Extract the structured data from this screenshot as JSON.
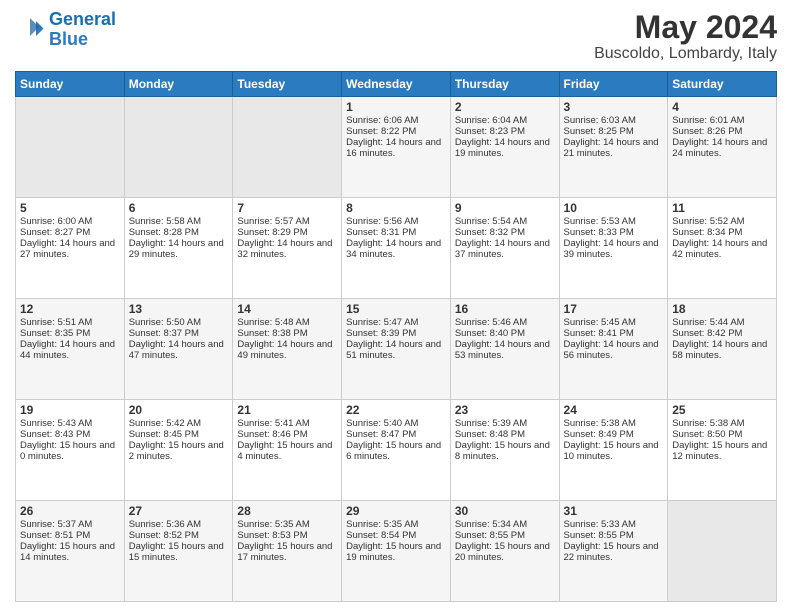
{
  "logo": {
    "line1": "General",
    "line2": "Blue"
  },
  "title": "May 2024",
  "location": "Buscoldo, Lombardy, Italy",
  "days_of_week": [
    "Sunday",
    "Monday",
    "Tuesday",
    "Wednesday",
    "Thursday",
    "Friday",
    "Saturday"
  ],
  "weeks": [
    [
      {
        "day": "",
        "empty": true
      },
      {
        "day": "",
        "empty": true
      },
      {
        "day": "",
        "empty": true
      },
      {
        "day": "1",
        "sunrise": "6:06 AM",
        "sunset": "8:22 PM",
        "daylight": "14 hours and 16 minutes."
      },
      {
        "day": "2",
        "sunrise": "6:04 AM",
        "sunset": "8:23 PM",
        "daylight": "14 hours and 19 minutes."
      },
      {
        "day": "3",
        "sunrise": "6:03 AM",
        "sunset": "8:25 PM",
        "daylight": "14 hours and 21 minutes."
      },
      {
        "day": "4",
        "sunrise": "6:01 AM",
        "sunset": "8:26 PM",
        "daylight": "14 hours and 24 minutes."
      }
    ],
    [
      {
        "day": "5",
        "sunrise": "6:00 AM",
        "sunset": "8:27 PM",
        "daylight": "14 hours and 27 minutes."
      },
      {
        "day": "6",
        "sunrise": "5:58 AM",
        "sunset": "8:28 PM",
        "daylight": "14 hours and 29 minutes."
      },
      {
        "day": "7",
        "sunrise": "5:57 AM",
        "sunset": "8:29 PM",
        "daylight": "14 hours and 32 minutes."
      },
      {
        "day": "8",
        "sunrise": "5:56 AM",
        "sunset": "8:31 PM",
        "daylight": "14 hours and 34 minutes."
      },
      {
        "day": "9",
        "sunrise": "5:54 AM",
        "sunset": "8:32 PM",
        "daylight": "14 hours and 37 minutes."
      },
      {
        "day": "10",
        "sunrise": "5:53 AM",
        "sunset": "8:33 PM",
        "daylight": "14 hours and 39 minutes."
      },
      {
        "day": "11",
        "sunrise": "5:52 AM",
        "sunset": "8:34 PM",
        "daylight": "14 hours and 42 minutes."
      }
    ],
    [
      {
        "day": "12",
        "sunrise": "5:51 AM",
        "sunset": "8:35 PM",
        "daylight": "14 hours and 44 minutes."
      },
      {
        "day": "13",
        "sunrise": "5:50 AM",
        "sunset": "8:37 PM",
        "daylight": "14 hours and 47 minutes."
      },
      {
        "day": "14",
        "sunrise": "5:48 AM",
        "sunset": "8:38 PM",
        "daylight": "14 hours and 49 minutes."
      },
      {
        "day": "15",
        "sunrise": "5:47 AM",
        "sunset": "8:39 PM",
        "daylight": "14 hours and 51 minutes."
      },
      {
        "day": "16",
        "sunrise": "5:46 AM",
        "sunset": "8:40 PM",
        "daylight": "14 hours and 53 minutes."
      },
      {
        "day": "17",
        "sunrise": "5:45 AM",
        "sunset": "8:41 PM",
        "daylight": "14 hours and 56 minutes."
      },
      {
        "day": "18",
        "sunrise": "5:44 AM",
        "sunset": "8:42 PM",
        "daylight": "14 hours and 58 minutes."
      }
    ],
    [
      {
        "day": "19",
        "sunrise": "5:43 AM",
        "sunset": "8:43 PM",
        "daylight": "15 hours and 0 minutes."
      },
      {
        "day": "20",
        "sunrise": "5:42 AM",
        "sunset": "8:45 PM",
        "daylight": "15 hours and 2 minutes."
      },
      {
        "day": "21",
        "sunrise": "5:41 AM",
        "sunset": "8:46 PM",
        "daylight": "15 hours and 4 minutes."
      },
      {
        "day": "22",
        "sunrise": "5:40 AM",
        "sunset": "8:47 PM",
        "daylight": "15 hours and 6 minutes."
      },
      {
        "day": "23",
        "sunrise": "5:39 AM",
        "sunset": "8:48 PM",
        "daylight": "15 hours and 8 minutes."
      },
      {
        "day": "24",
        "sunrise": "5:38 AM",
        "sunset": "8:49 PM",
        "daylight": "15 hours and 10 minutes."
      },
      {
        "day": "25",
        "sunrise": "5:38 AM",
        "sunset": "8:50 PM",
        "daylight": "15 hours and 12 minutes."
      }
    ],
    [
      {
        "day": "26",
        "sunrise": "5:37 AM",
        "sunset": "8:51 PM",
        "daylight": "15 hours and 14 minutes."
      },
      {
        "day": "27",
        "sunrise": "5:36 AM",
        "sunset": "8:52 PM",
        "daylight": "15 hours and 15 minutes."
      },
      {
        "day": "28",
        "sunrise": "5:35 AM",
        "sunset": "8:53 PM",
        "daylight": "15 hours and 17 minutes."
      },
      {
        "day": "29",
        "sunrise": "5:35 AM",
        "sunset": "8:54 PM",
        "daylight": "15 hours and 19 minutes."
      },
      {
        "day": "30",
        "sunrise": "5:34 AM",
        "sunset": "8:55 PM",
        "daylight": "15 hours and 20 minutes."
      },
      {
        "day": "31",
        "sunrise": "5:33 AM",
        "sunset": "8:55 PM",
        "daylight": "15 hours and 22 minutes."
      },
      {
        "day": "",
        "empty": true
      }
    ]
  ]
}
